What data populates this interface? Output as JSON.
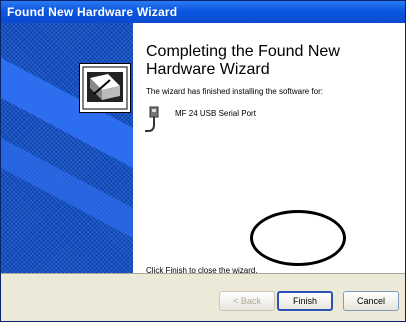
{
  "window": {
    "title": "Found New Hardware Wizard"
  },
  "main": {
    "heading": "Completing the Found New Hardware Wizard",
    "subtext": "The wizard has finished installing the software for:",
    "device_name": "MF 24 USB Serial Port",
    "finish_text": "Click Finish to close the wizard."
  },
  "footer": {
    "back_label": "< Back",
    "finish_label": "Finish",
    "cancel_label": "Cancel"
  },
  "icons": {
    "wizard": "hardware-wizard-icon",
    "device": "usb-cable-icon"
  }
}
